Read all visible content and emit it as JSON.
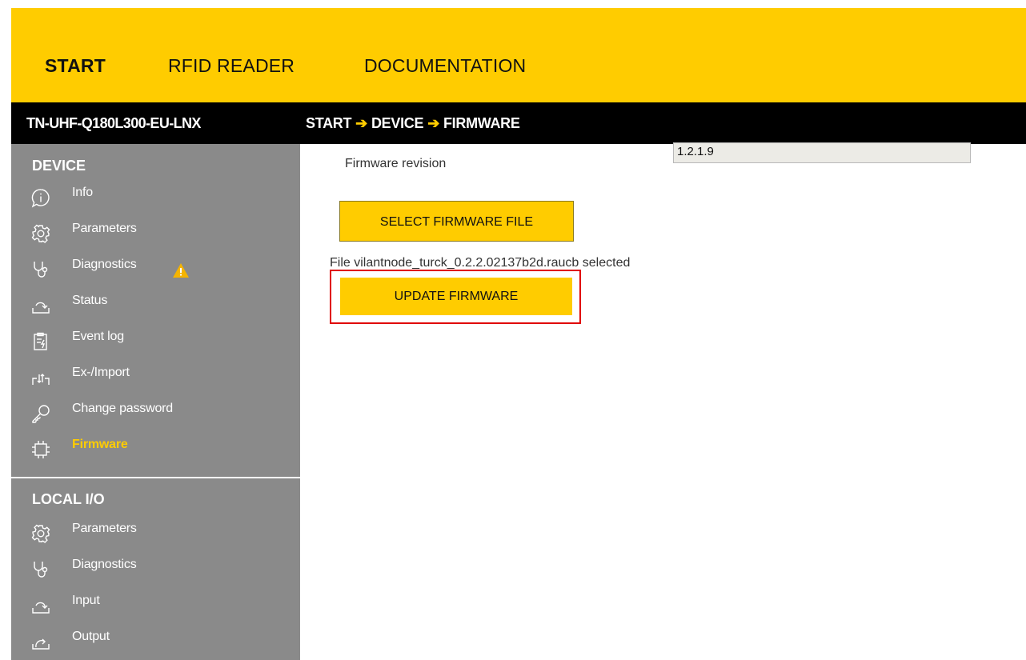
{
  "top_nav": {
    "items": [
      "START",
      "RFID READER",
      "DOCUMENTATION"
    ],
    "active": "START",
    "accent": "#ffcc00"
  },
  "header": {
    "device_name": "TN-UHF-Q180L300-EU-LNX",
    "breadcrumb": [
      "START",
      "DEVICE",
      "FIRMWARE"
    ],
    "breadcrumb_separator": "➔"
  },
  "sidebar": {
    "device_section": {
      "title": "DEVICE",
      "items": [
        {
          "label": "Info",
          "icon": "info-icon"
        },
        {
          "label": "Parameters",
          "icon": "gear-icon"
        },
        {
          "label": "Diagnostics",
          "icon": "stethoscope-icon",
          "warning": true
        },
        {
          "label": "Status",
          "icon": "status-arrow-icon"
        },
        {
          "label": "Event log",
          "icon": "clipboard-icon"
        },
        {
          "label": "Ex-/Import",
          "icon": "import-export-icon"
        },
        {
          "label": "Change password",
          "icon": "key-icon"
        },
        {
          "label": "Firmware",
          "icon": "chip-icon",
          "active": true
        }
      ]
    },
    "local_io_section": {
      "title": "LOCAL I/O",
      "items": [
        {
          "label": "Parameters",
          "icon": "gear-icon"
        },
        {
          "label": "Diagnostics",
          "icon": "stethoscope-icon"
        },
        {
          "label": "Input",
          "icon": "input-arrow-icon"
        },
        {
          "label": "Output",
          "icon": "output-arrow-icon"
        }
      ]
    }
  },
  "main": {
    "firmware_revision_label": "Firmware revision",
    "firmware_revision_value": "1.2.1.9",
    "select_button": "SELECT FIRMWARE FILE",
    "file_status": "File vilantnode_turck_0.2.2.02137b2d.raucb selected",
    "update_button": "UPDATE FIRMWARE"
  },
  "colors": {
    "accent_yellow": "#ffcc00",
    "sidebar_gray": "#8a8a8a",
    "header_black": "#000000",
    "highlight_red": "#e00000",
    "warning_orange": "#f5b400"
  }
}
